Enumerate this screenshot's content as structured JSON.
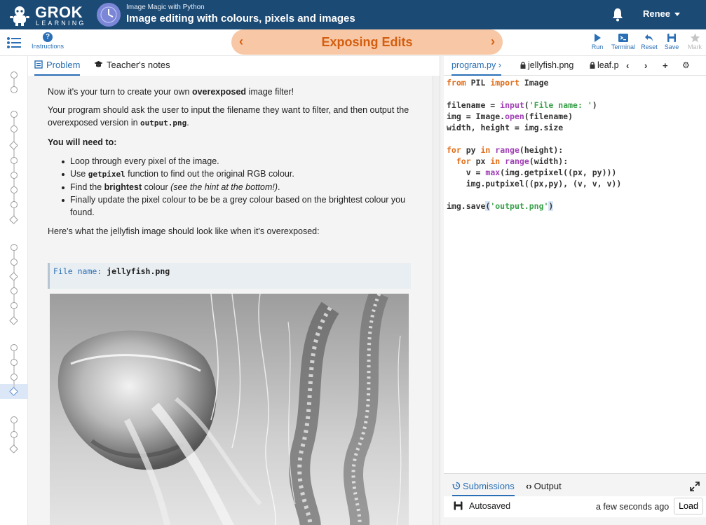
{
  "header": {
    "logo_main": "GROK",
    "logo_sub": "LEARNING",
    "course_subtitle": "Image Magic with Python",
    "course_title": "Image editing with colours, pixels and images",
    "user_name": "Renee"
  },
  "toolbar": {
    "instructions_label": "Instructions",
    "slide_title": "Exposing Edits",
    "run_label": "Run",
    "terminal_label": "Terminal",
    "reset_label": "Reset",
    "save_label": "Save",
    "mark_label": "Mark"
  },
  "problem": {
    "tabs": [
      {
        "label": "Problem"
      },
      {
        "label": "Teacher's notes"
      }
    ],
    "intro_before": "Now it's your turn to create your own ",
    "intro_bold": "overexposed",
    "intro_after": " image filter!",
    "para2_before": "Your program should ask the user to input the filename they want to filter, and then output the overexposed version in ",
    "para2_code": "output.png",
    "para2_after": ".",
    "need_heading": "You will need to:",
    "bullets": {
      "b1": "Loop through every pixel of the image.",
      "b2_before": "Use ",
      "b2_code": "getpixel",
      "b2_after": " function to find out the original RGB colour.",
      "b3_before": "Find the ",
      "b3_bold": "brightest",
      "b3_mid": " colour ",
      "b3_italic": "(see the hint at the bottom!)",
      "b3_after": ".",
      "b4": "Finally update the pixel colour to be be a grey colour based on the brightest colour you found."
    },
    "jelly_caption": "Here's what the jellyfish image should look like when it's overexposed:",
    "console_prompt": "File name: ",
    "console_input": "jellyfish.png"
  },
  "editor": {
    "tabs": [
      {
        "label": "program.py"
      },
      {
        "label": "jellyfish.png"
      },
      {
        "label": "leaf.p"
      }
    ],
    "code_lines": {
      "l1": [
        "from",
        " PIL ",
        "import",
        " Image"
      ],
      "l3": [
        "filename = ",
        "input",
        "(",
        "'File name: '",
        ")"
      ],
      "l4": [
        "img = Image.",
        "open",
        "(filename)"
      ],
      "l5": [
        "width, height = img.size"
      ],
      "l7": [
        "for",
        " py ",
        "in",
        " ",
        "range",
        "(height):"
      ],
      "l8": [
        "  ",
        "for",
        " px ",
        "in",
        " ",
        "range",
        "(width):"
      ],
      "l9": [
        "    v = ",
        "max",
        "(img.getpixel((px, py)))"
      ],
      "l10": [
        "    img.putpixel((px,py), (v, v, v))"
      ],
      "l12": [
        "img.save",
        "(",
        "'output.png'",
        ")"
      ]
    }
  },
  "bottom": {
    "tabs": [
      {
        "label": "Submissions"
      },
      {
        "label": "Output"
      }
    ],
    "status": "Autosaved",
    "time": "a few seconds ago",
    "load_label": "Load"
  },
  "colors": {
    "header_bg": "#1b4a75",
    "accent": "#2a6fb5",
    "pill_bg": "#f8c8a6",
    "pill_text": "#d35e10",
    "keyword": "#e06c16",
    "builtin": "#a03fb6",
    "string": "#39a04b"
  }
}
